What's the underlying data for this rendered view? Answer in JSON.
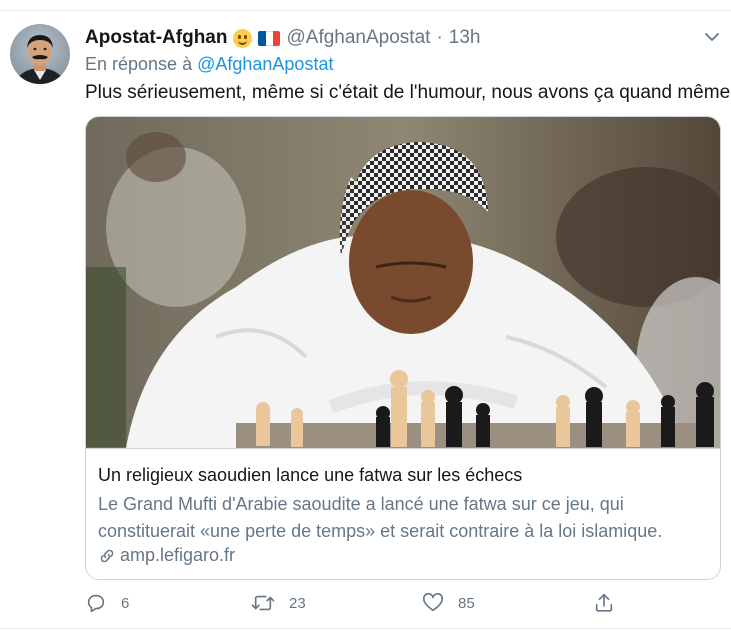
{
  "tweet": {
    "author": {
      "display_name": "Apostat-Afghan",
      "handle": "@AfghanApostat",
      "emoji_icons": [
        "slightly-smiling-face-icon",
        "france-flag-icon"
      ]
    },
    "dot": "·",
    "time": "13h",
    "reply_prefix": "En réponse à",
    "reply_to": "@AfghanApostat",
    "text": "Plus sérieusement, même si c'était de l'humour, nous avons ça quand même"
  },
  "card": {
    "image_subject": "chess-player-photo",
    "title": "Un religieux saoudien lance une fatwa sur les échecs",
    "description": "Le Grand Mufti d'Arabie saoudite a lancé une fatwa sur ce jeu, qui constituerait «une perte de temps» et serait contraire à la loi islamique.",
    "domain": "amp.lefigaro.fr"
  },
  "actions": {
    "reply_count": "6",
    "retweet_count": "23",
    "like_count": "85"
  },
  "colors": {
    "text": "#14171a",
    "secondary": "#657786",
    "link": "#1b95e0",
    "border": "#ccd6dd",
    "flag_blue": "#0055a4",
    "flag_white": "#ffffff",
    "flag_red": "#ef4135"
  }
}
